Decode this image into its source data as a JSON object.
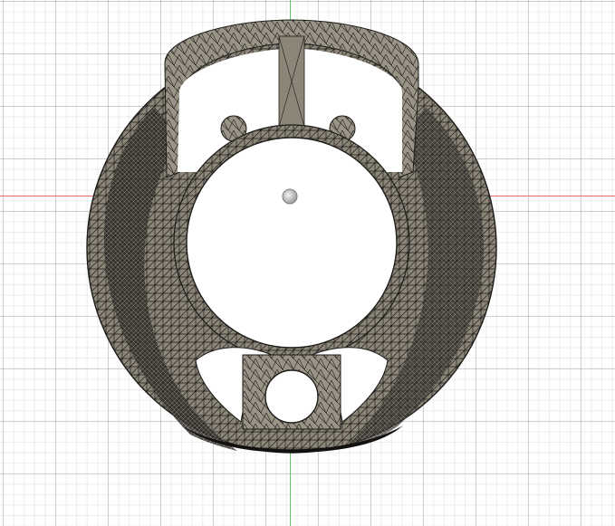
{
  "viewport": {
    "view": "front",
    "grid": true,
    "colors": {
      "background": "#ffffff",
      "grid_major": "#b4b4b4",
      "grid_minor": "#d2d2d2",
      "axis_x": "#e46a6a",
      "axis_y": "#5cc46a",
      "mesh_fill": "#8c8679",
      "mesh_edge": "#1d1c19",
      "origin_marker": "#bdbdbd"
    },
    "icons": {
      "origin": "origin-point-icon",
      "model": "triangulated-mesh-body"
    }
  }
}
